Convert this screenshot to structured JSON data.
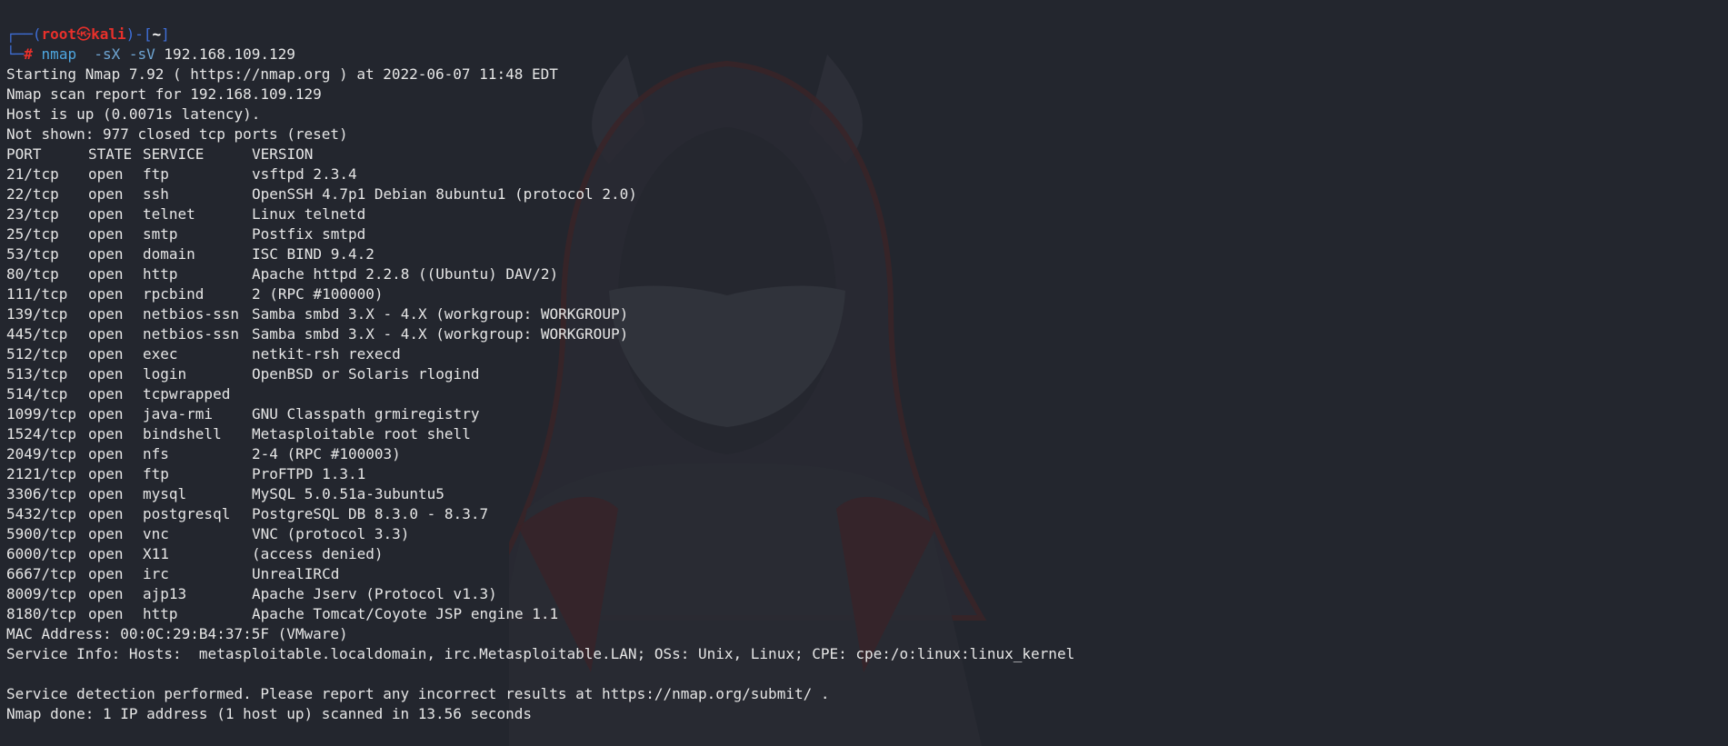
{
  "prompt": {
    "corner_top": "┌──(",
    "user": "root",
    "at_symbol": "㉿",
    "host": "kali",
    "sep": ")-[",
    "path": "~",
    "close": "]",
    "corner_bottom": "└─",
    "hash": "#",
    "command": "nmap",
    "flags": "-sX -sV",
    "target": "192.168.109.129"
  },
  "header_lines": [
    "Starting Nmap 7.92 ( https://nmap.org ) at 2022-06-07 11:48 EDT",
    "Nmap scan report for 192.168.109.129",
    "Host is up (0.0071s latency).",
    "Not shown: 977 closed tcp ports (reset)"
  ],
  "table": {
    "columns": [
      "PORT",
      "STATE",
      "SERVICE",
      "VERSION"
    ],
    "rows": [
      [
        "21/tcp",
        "open",
        "ftp",
        "vsftpd 2.3.4"
      ],
      [
        "22/tcp",
        "open",
        "ssh",
        "OpenSSH 4.7p1 Debian 8ubuntu1 (protocol 2.0)"
      ],
      [
        "23/tcp",
        "open",
        "telnet",
        "Linux telnetd"
      ],
      [
        "25/tcp",
        "open",
        "smtp",
        "Postfix smtpd"
      ],
      [
        "53/tcp",
        "open",
        "domain",
        "ISC BIND 9.4.2"
      ],
      [
        "80/tcp",
        "open",
        "http",
        "Apache httpd 2.2.8 ((Ubuntu) DAV/2)"
      ],
      [
        "111/tcp",
        "open",
        "rpcbind",
        "2 (RPC #100000)"
      ],
      [
        "139/tcp",
        "open",
        "netbios-ssn",
        "Samba smbd 3.X - 4.X (workgroup: WORKGROUP)"
      ],
      [
        "445/tcp",
        "open",
        "netbios-ssn",
        "Samba smbd 3.X - 4.X (workgroup: WORKGROUP)"
      ],
      [
        "512/tcp",
        "open",
        "exec",
        "netkit-rsh rexecd"
      ],
      [
        "513/tcp",
        "open",
        "login",
        "OpenBSD or Solaris rlogind"
      ],
      [
        "514/tcp",
        "open",
        "tcpwrapped",
        ""
      ],
      [
        "1099/tcp",
        "open",
        "java-rmi",
        "GNU Classpath grmiregistry"
      ],
      [
        "1524/tcp",
        "open",
        "bindshell",
        "Metasploitable root shell"
      ],
      [
        "2049/tcp",
        "open",
        "nfs",
        "2-4 (RPC #100003)"
      ],
      [
        "2121/tcp",
        "open",
        "ftp",
        "ProFTPD 1.3.1"
      ],
      [
        "3306/tcp",
        "open",
        "mysql",
        "MySQL 5.0.51a-3ubuntu5"
      ],
      [
        "5432/tcp",
        "open",
        "postgresql",
        "PostgreSQL DB 8.3.0 - 8.3.7"
      ],
      [
        "5900/tcp",
        "open",
        "vnc",
        "VNC (protocol 3.3)"
      ],
      [
        "6000/tcp",
        "open",
        "X11",
        "(access denied)"
      ],
      [
        "6667/tcp",
        "open",
        "irc",
        "UnrealIRCd"
      ],
      [
        "8009/tcp",
        "open",
        "ajp13",
        "Apache Jserv (Protocol v1.3)"
      ],
      [
        "8180/tcp",
        "open",
        "http",
        "Apache Tomcat/Coyote JSP engine 1.1"
      ]
    ]
  },
  "footer_lines": [
    "MAC Address: 00:0C:29:B4:37:5F (VMware)",
    "Service Info: Hosts:  metasploitable.localdomain, irc.Metasploitable.LAN; OSs: Unix, Linux; CPE: cpe:/o:linux:linux_kernel",
    "",
    "Service detection performed. Please report any incorrect results at https://nmap.org/submit/ .",
    "Nmap done: 1 IP address (1 host up) scanned in 13.56 seconds"
  ],
  "colors": {
    "background": "#23262e",
    "text": "#e6e6e6",
    "prompt_box": "#3f6fd8",
    "prompt_user": "#e8302b",
    "command": "#4ea7e0"
  },
  "wallpaper_icon": "hooded-devil-wallpaper"
}
